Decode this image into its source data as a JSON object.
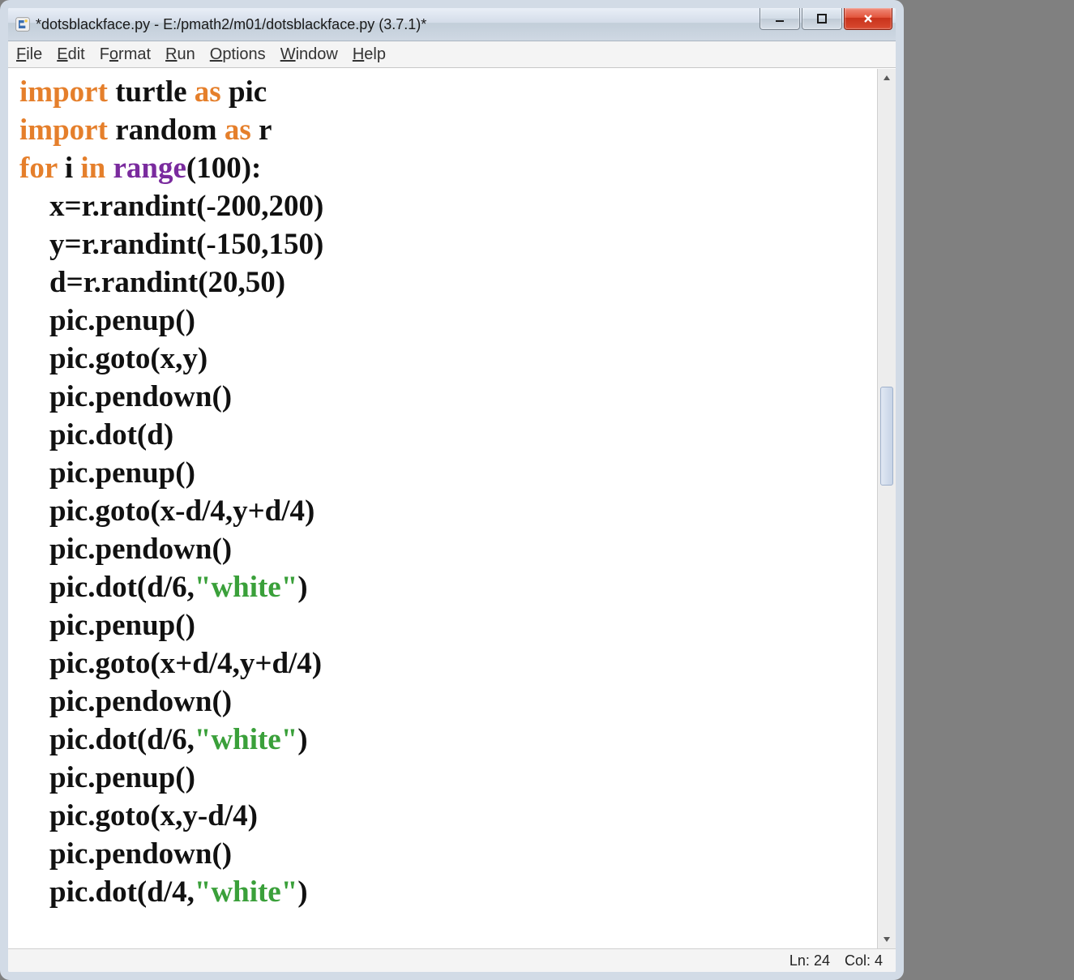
{
  "title": "*dotsblackface.py - E:/pmath2/m01/dotsblackface.py (3.7.1)*",
  "menu": {
    "file": "File",
    "edit": "Edit",
    "format": "Format",
    "run": "Run",
    "options": "Options",
    "window": "Window",
    "help": "Help"
  },
  "code": {
    "kw_import1": "import",
    "mod_turtle": " turtle ",
    "kw_as1": "as",
    "alias_pic": " pic",
    "kw_import2": "import",
    "mod_random": " random ",
    "kw_as2": "as",
    "alias_r": " r",
    "kw_for": "for",
    "var_i": " i ",
    "kw_in": "in",
    "sp": " ",
    "fn_range": "range",
    "range_args": "(100):",
    "l4": "    x=r.randint(-200,200)",
    "l5": "    y=r.randint(-150,150)",
    "l6": "    d=r.randint(20,50)",
    "l7": "    pic.penup()",
    "l8": "    pic.goto(x,y)",
    "l9": "    pic.pendown()",
    "l10": "    pic.dot(d)",
    "l11": "    pic.penup()",
    "l12": "    pic.goto(x-d/4,y+d/4)",
    "l13": "    pic.pendown()",
    "l14a": "    pic.dot(d/6,",
    "str_white1": "\"white\"",
    "l14b": ")",
    "l15": "    pic.penup()",
    "l16": "    pic.goto(x+d/4,y+d/4)",
    "l17": "    pic.pendown()",
    "l18a": "    pic.dot(d/6,",
    "str_white2": "\"white\"",
    "l18b": ")",
    "l19": "    pic.penup()",
    "l20": "    pic.goto(x,y-d/4)",
    "l21": "    pic.pendown()",
    "l22a": "    pic.dot(d/4,",
    "str_white3": "\"white\"",
    "l22b": ")"
  },
  "status": {
    "line_label": "Ln: ",
    "line_val": "24",
    "col_label": "Col: ",
    "col_val": "4"
  }
}
